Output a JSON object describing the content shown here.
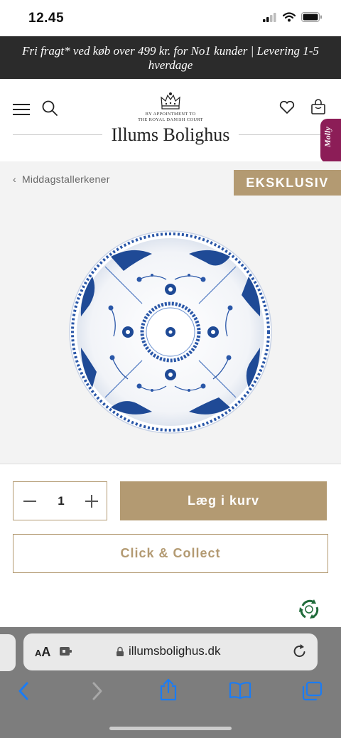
{
  "status_bar": {
    "time": "12.45"
  },
  "promo": {
    "text": "Fri fragt* ved køb over 499 kr. for No1 kunder | Levering 1-5 hverdage"
  },
  "header": {
    "appointment_line1": "BY APPOINTMENT TO",
    "appointment_line2": "THE ROYAL DANISH COURT",
    "logo": "Illums Bolighus",
    "chat_tab": "Molly"
  },
  "product": {
    "breadcrumb": "Middagstallerkener",
    "badge": "EKSKLUSIV"
  },
  "purchase": {
    "quantity": "1",
    "add_to_cart_label": "Læg i kurv",
    "click_collect_label": "Click & Collect"
  },
  "browser": {
    "text_size_label_small": "A",
    "text_size_label_large": "A",
    "url": "illumsbolighus.dk"
  },
  "colors": {
    "accent": "#b39a72",
    "promo_bg": "#2b2b2b",
    "chat_tab": "#8c1d57",
    "plate_blue": "#2a57a8"
  },
  "icons": [
    "signal-icon",
    "wifi-icon",
    "battery-icon",
    "menu-icon",
    "search-icon",
    "crown-icon",
    "heart-icon",
    "bag-icon",
    "recycle-icon",
    "lock-icon",
    "reload-icon",
    "back-icon",
    "forward-icon",
    "share-icon",
    "bookmarks-icon",
    "tabs-icon"
  ]
}
